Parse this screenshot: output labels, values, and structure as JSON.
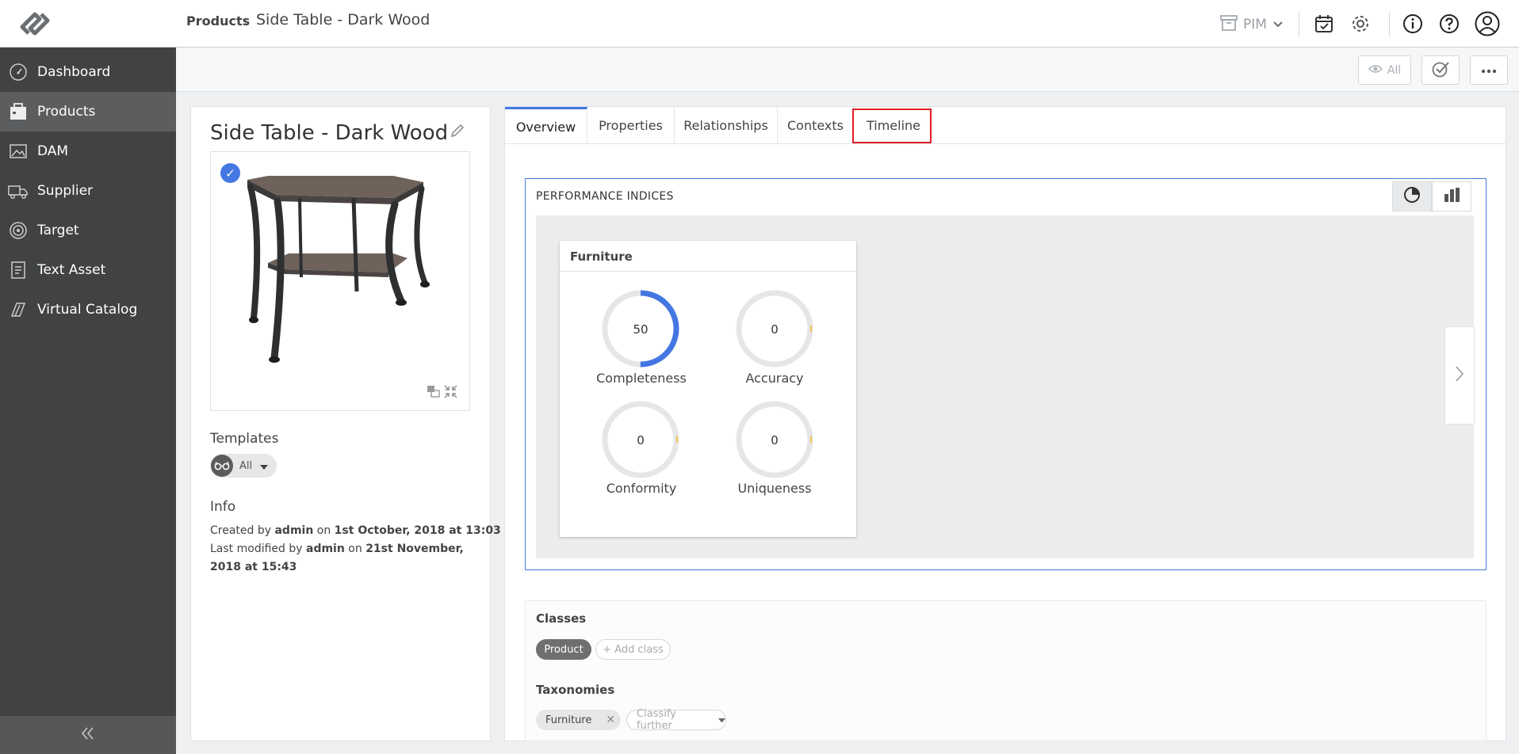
{
  "header": {
    "app_switch_label": "PIM"
  },
  "sidebar": {
    "items": [
      {
        "label": "Dashboard",
        "icon": "dashboard-gauge-icon"
      },
      {
        "label": "Products",
        "icon": "products-box-icon"
      },
      {
        "label": "DAM",
        "icon": "image-icon"
      },
      {
        "label": "Supplier",
        "icon": "truck-icon"
      },
      {
        "label": "Target",
        "icon": "target-icon"
      },
      {
        "label": "Text Asset",
        "icon": "document-icon"
      },
      {
        "label": "Virtual Catalog",
        "icon": "catalog-icon"
      }
    ],
    "active_index": 1
  },
  "breadcrumb": {
    "root": "Products",
    "separator": "›",
    "current": "Side Table - Dark Wood"
  },
  "toolbar": {
    "view_label": "All"
  },
  "product": {
    "title": "Side Table - Dark Wood",
    "templates_label": "Templates",
    "template_value": "All",
    "info_label": "Info",
    "created_prefix": "Created by",
    "created_by": "admin",
    "on_word": "on",
    "created_date": "1st October, 2018 at 13:03",
    "modified_prefix": "Last modified by",
    "modified_by": "admin",
    "modified_date_line1": "21st November,",
    "modified_date_line2": "2018 at 15:43"
  },
  "tabs": [
    {
      "label": "Overview",
      "active": true
    },
    {
      "label": "Properties",
      "active": false
    },
    {
      "label": "Relationships",
      "active": false
    },
    {
      "label": "Contexts",
      "active": false
    },
    {
      "label": "Timeline",
      "active": false
    }
  ],
  "performance": {
    "title": "PERFORMANCE INDICES",
    "card_title": "Furniture",
    "metrics": [
      {
        "label": "Completeness",
        "value": "50",
        "fraction": 0.5
      },
      {
        "label": "Accuracy",
        "value": "0",
        "fraction": 0
      },
      {
        "label": "Conformity",
        "value": "0",
        "fraction": 0
      },
      {
        "label": "Uniqueness",
        "value": "0",
        "fraction": 0
      }
    ]
  },
  "classes": {
    "title": "Classes",
    "chip": "Product",
    "add_label": "+ Add class"
  },
  "taxonomies": {
    "title": "Taxonomies",
    "chip": "Furniture",
    "classify_label": "Classify further"
  },
  "colors": {
    "accent": "#4477e2",
    "sidebar_bg": "#404243",
    "highlight_box": "#e31e24",
    "gauge_track": "#e6e6e6"
  }
}
